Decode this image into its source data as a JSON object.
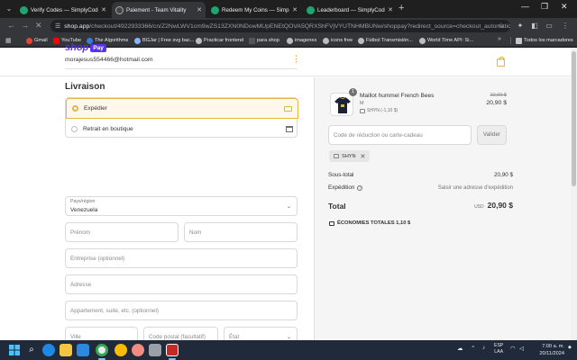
{
  "browser": {
    "tabs": [
      {
        "title": "Verify Codes — SimplyCodes",
        "color": "#1ea672"
      },
      {
        "title": "Paiement - Team Vitality",
        "color": "#444444"
      },
      {
        "title": "Redeem My Coins — SimplyCodes",
        "color": "#1ea672"
      },
      {
        "title": "Leaderboard — SimplyCodes",
        "color": "#1ea672"
      }
    ],
    "url_host": "shop.app",
    "url_path": "/checkout/4922933366/cn/Z2NwLWV1cm9wZS13ZXN0NDowMUpENEtQOVA5QRXShFVjVYUTNHMBUNw/shoppay?redirect_source=checkout_automatic_r...",
    "bookmarks": [
      {
        "label": "Gmail"
      },
      {
        "label": "YouTube"
      },
      {
        "label": "The Algorithms"
      },
      {
        "label": "BGJar | Free svg bac..."
      },
      {
        "label": "Practicar frontend"
      },
      {
        "label": "para shop"
      },
      {
        "label": "imagenes"
      },
      {
        "label": "icons free"
      },
      {
        "label": "Fútbol Transmisión..."
      },
      {
        "label": "World Time API: Si..."
      }
    ],
    "bookmarks_all": "Todos los marcadores"
  },
  "checkout": {
    "shop_word": "shop",
    "pay_word": "Pay",
    "email": "morajesus554466@hotmail.com",
    "section_title": "Livraison",
    "options": [
      {
        "label": "Expédier",
        "selected": true
      },
      {
        "label": "Retrait en boutique",
        "selected": false
      }
    ],
    "country_label": "Pays/région",
    "country_value": "Venezuela",
    "first_name_ph": "Prénom",
    "last_name_ph": "Nom",
    "company_ph": "Entreprise (optionnel)",
    "address_ph": "Adresse",
    "apt_ph": "Appartement, suite, etc. (optionnel)",
    "city_ph": "Ville",
    "postal_ph": "Code postal (facultatif)",
    "state_ph": "État"
  },
  "summary": {
    "item_name": "Maillot hummel French Bees",
    "item_size": "M",
    "item_discount": "SHYN (-1,10 $)",
    "item_qty": "1",
    "price_old": "22,00 $",
    "price_new": "20,90 $",
    "promo_ph": "Code de réduction ou carte-cadeau",
    "apply_label": "Valider",
    "chip_code": "SHYN",
    "subtotal_label": "Sous-total",
    "subtotal_value": "20,90 $",
    "shipping_label": "Expédition",
    "shipping_value": "Saisir une adresse d'expédition",
    "total_label": "Total",
    "currency": "USD",
    "total_value": "20,90 $",
    "savings": "ÉCONOMIES TOTALES  1,10 $"
  },
  "taskbar": {
    "lang_top": "ESP",
    "lang_bottom": "LAA",
    "time": "7:00 a. m.",
    "date": "20/11/2024"
  },
  "colors": {
    "accent": "#e4b63f",
    "shop_purple": "#5a31f4"
  }
}
